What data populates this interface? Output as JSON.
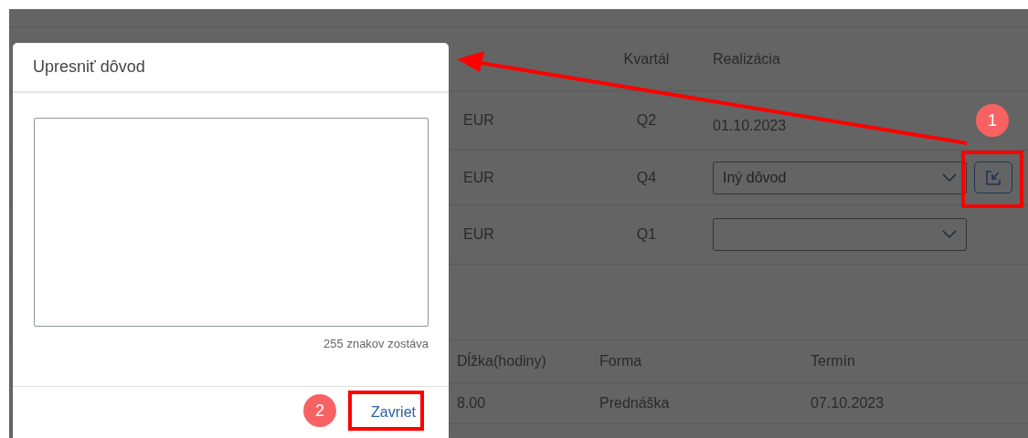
{
  "table": {
    "columns": [
      "Kvartál",
      "Realizácia"
    ],
    "rows": [
      {
        "currency": "EUR",
        "quarter": "Q2",
        "realization": {
          "kind": "date",
          "value": "01.10.2023"
        },
        "action_button": false
      },
      {
        "currency": "EUR",
        "quarter": "Q4",
        "realization": {
          "kind": "select",
          "value": "Iný dôvod"
        },
        "action_button": true
      },
      {
        "currency": "EUR",
        "quarter": "Q1",
        "realization": {
          "kind": "select"
        },
        "action_button": false
      }
    ]
  },
  "trainings": {
    "columns": [
      "Dĺžka(hodiny)",
      "Forma",
      "Termín"
    ],
    "rows": [
      [
        "8.00",
        "Prednáška",
        "07.10.2023"
      ]
    ]
  },
  "dialog": {
    "title": "Upresniť dôvod",
    "counter": "255 znakov zostáva",
    "close_button": "Zavriet"
  },
  "annotations": [
    {
      "label": "1"
    },
    {
      "label": "2"
    }
  ]
}
